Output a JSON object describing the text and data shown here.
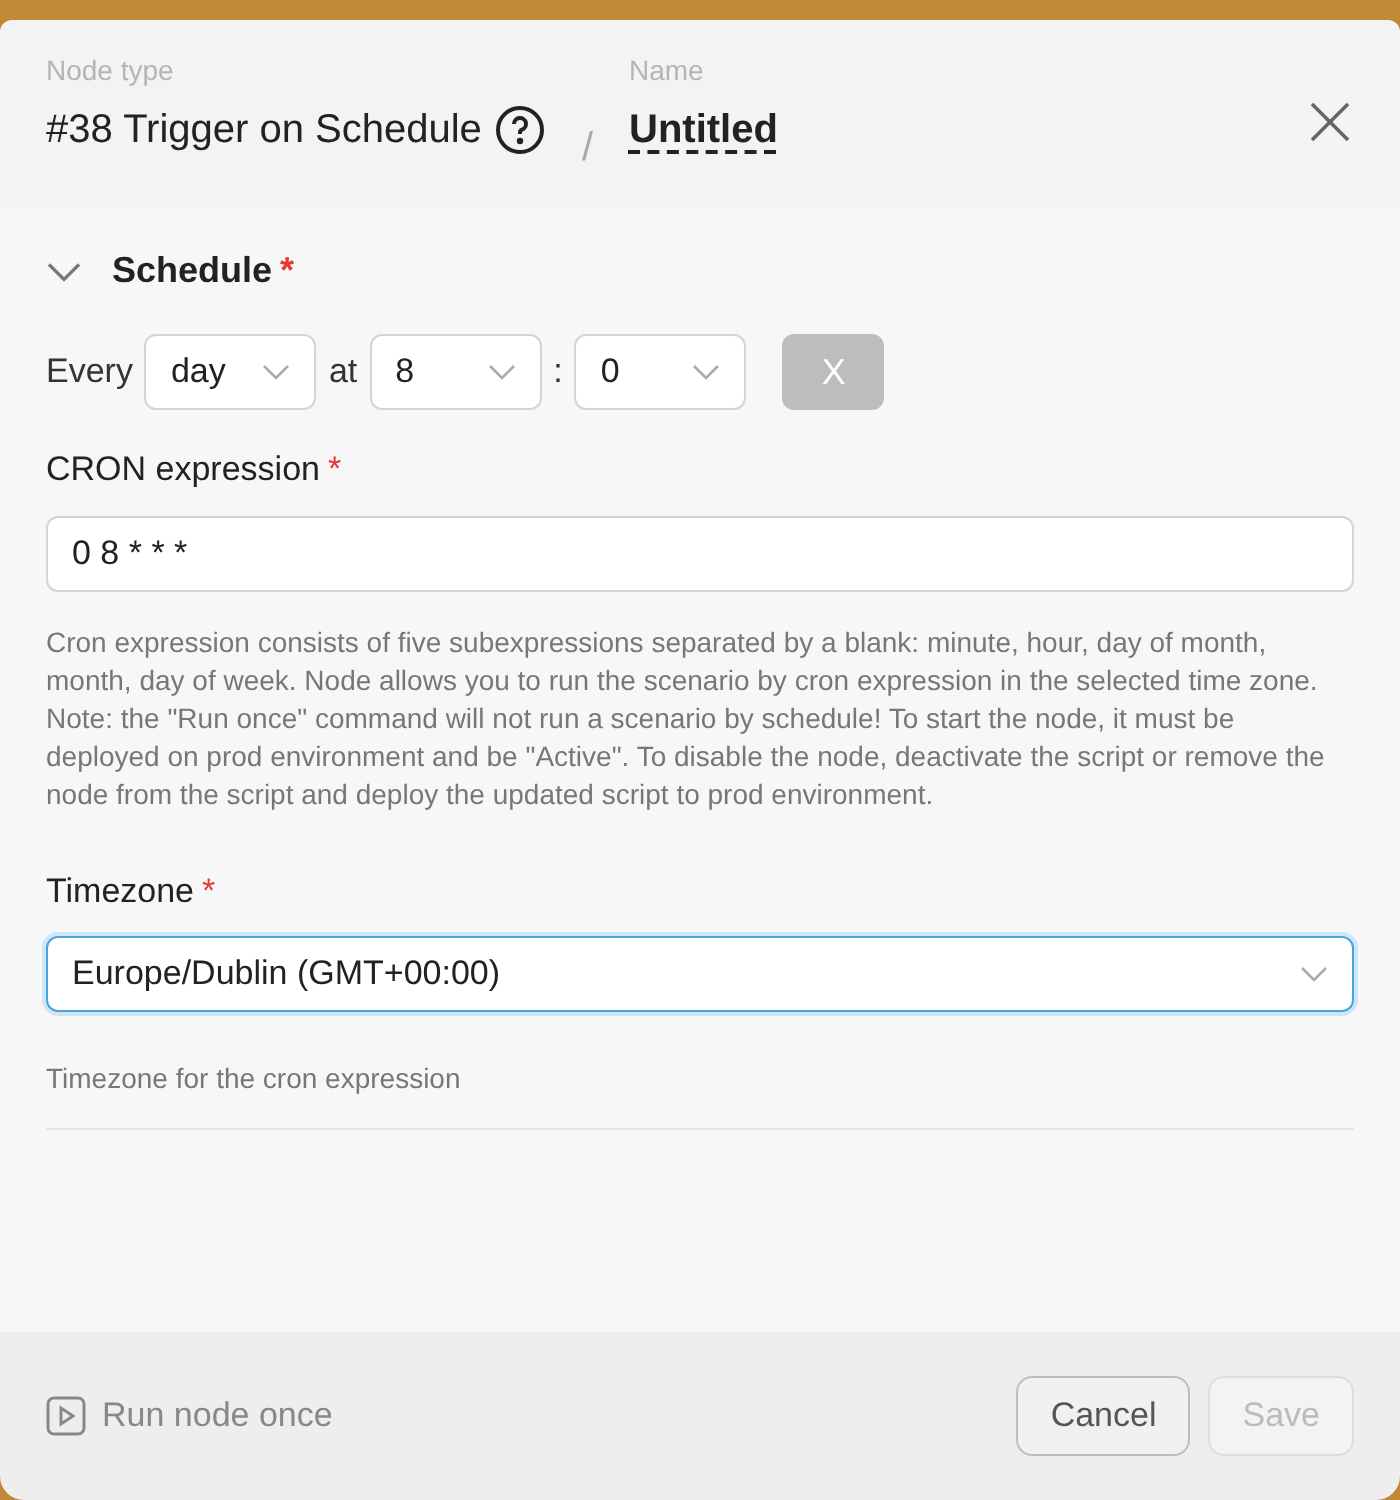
{
  "header": {
    "node_type_label": "Node type",
    "node_type": "#38 Trigger on Schedule",
    "name_label": "Name",
    "separator": "/",
    "name": "Untitled"
  },
  "section": {
    "title": "Schedule",
    "required_mark": "*",
    "expanded": true
  },
  "schedule": {
    "every_label": "Every",
    "period": "day",
    "at_label": "at",
    "hour": "8",
    "colon": ":",
    "minute": "0",
    "clear_button": {
      "label": "X",
      "disabled": true
    }
  },
  "cron": {
    "label": "CRON expression",
    "required_mark": "*",
    "value": "0 8 * * *",
    "help": "Cron expression consists of five subexpressions separated by a blank: minute, hour, day of month, month, day of week. Node allows you to run the scenario by cron expression in the selected time zone. Note: the \"Run once\" command will not run a scenario by schedule! To start the node, it must be deployed on prod environment and be \"Active\". To disable the node, deactivate the script or remove the node from the script and deploy the updated script to prod environment."
  },
  "timezone": {
    "label": "Timezone",
    "required_mark": "*",
    "value": "Europe/Dublin (GMT+00:00)",
    "focused": true,
    "help": "Timezone for the cron expression"
  },
  "footer": {
    "run_once": {
      "label": "Run node once",
      "disabled": true
    },
    "cancel": {
      "label": "Cancel",
      "disabled": false
    },
    "save": {
      "label": "Save",
      "disabled": true
    }
  }
}
